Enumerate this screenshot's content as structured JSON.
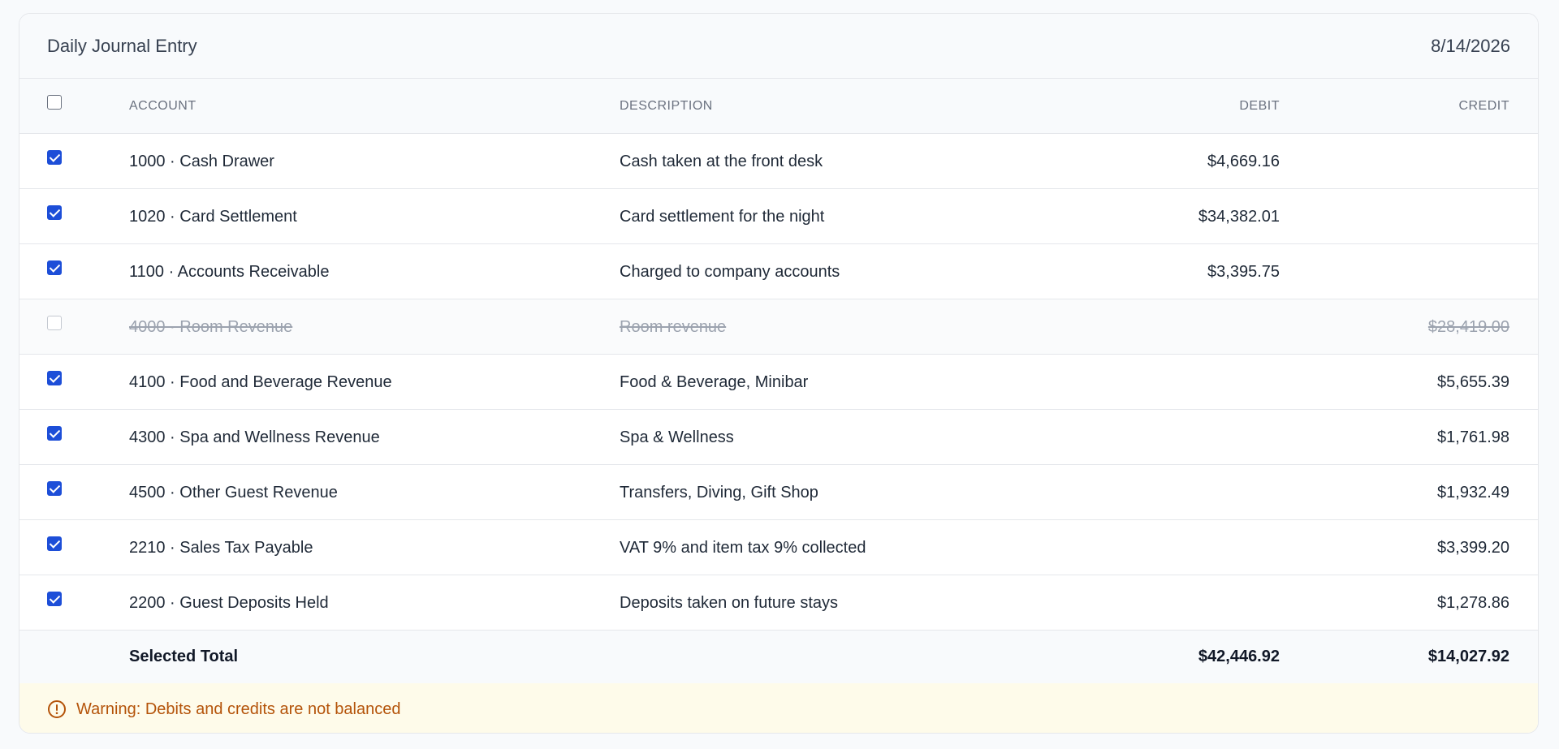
{
  "header": {
    "title": "Daily Journal Entry",
    "date": "8/14/2026"
  },
  "columns": {
    "account": "ACCOUNT",
    "description": "DESCRIPTION",
    "debit": "DEBIT",
    "credit": "CREDIT"
  },
  "select_all_checked": false,
  "rows": [
    {
      "checked": true,
      "account": "1000 · Cash Drawer",
      "description": "Cash taken at the front desk",
      "debit": "$4,669.16",
      "credit": ""
    },
    {
      "checked": true,
      "account": "1020 · Card Settlement",
      "description": "Card settlement for the night",
      "debit": "$34,382.01",
      "credit": ""
    },
    {
      "checked": true,
      "account": "1100 · Accounts Receivable",
      "description": "Charged to company accounts",
      "debit": "$3,395.75",
      "credit": ""
    },
    {
      "checked": false,
      "account": "4000 · Room Revenue",
      "description": "Room revenue",
      "debit": "",
      "credit": "$28,419.00"
    },
    {
      "checked": true,
      "account": "4100 · Food and Beverage Revenue",
      "description": "Food & Beverage, Minibar",
      "debit": "",
      "credit": "$5,655.39"
    },
    {
      "checked": true,
      "account": "4300 · Spa and Wellness Revenue",
      "description": "Spa & Wellness",
      "debit": "",
      "credit": "$1,761.98"
    },
    {
      "checked": true,
      "account": "4500 · Other Guest Revenue",
      "description": "Transfers, Diving, Gift Shop",
      "debit": "",
      "credit": "$1,932.49"
    },
    {
      "checked": true,
      "account": "2210 · Sales Tax Payable",
      "description": "VAT 9% and item tax 9% collected",
      "debit": "",
      "credit": "$3,399.20"
    },
    {
      "checked": true,
      "account": "2200 · Guest Deposits Held",
      "description": "Deposits taken on future stays",
      "debit": "",
      "credit": "$1,278.86"
    }
  ],
  "totals": {
    "label": "Selected Total",
    "debit": "$42,446.92",
    "credit": "$14,027.92"
  },
  "warning": {
    "icon": "alert-circle-icon",
    "text": "Warning: Debits and credits are not balanced"
  },
  "colors": {
    "accent": "#1d4ed8",
    "warning_text": "#b45309",
    "warning_bg": "#fefbea"
  }
}
